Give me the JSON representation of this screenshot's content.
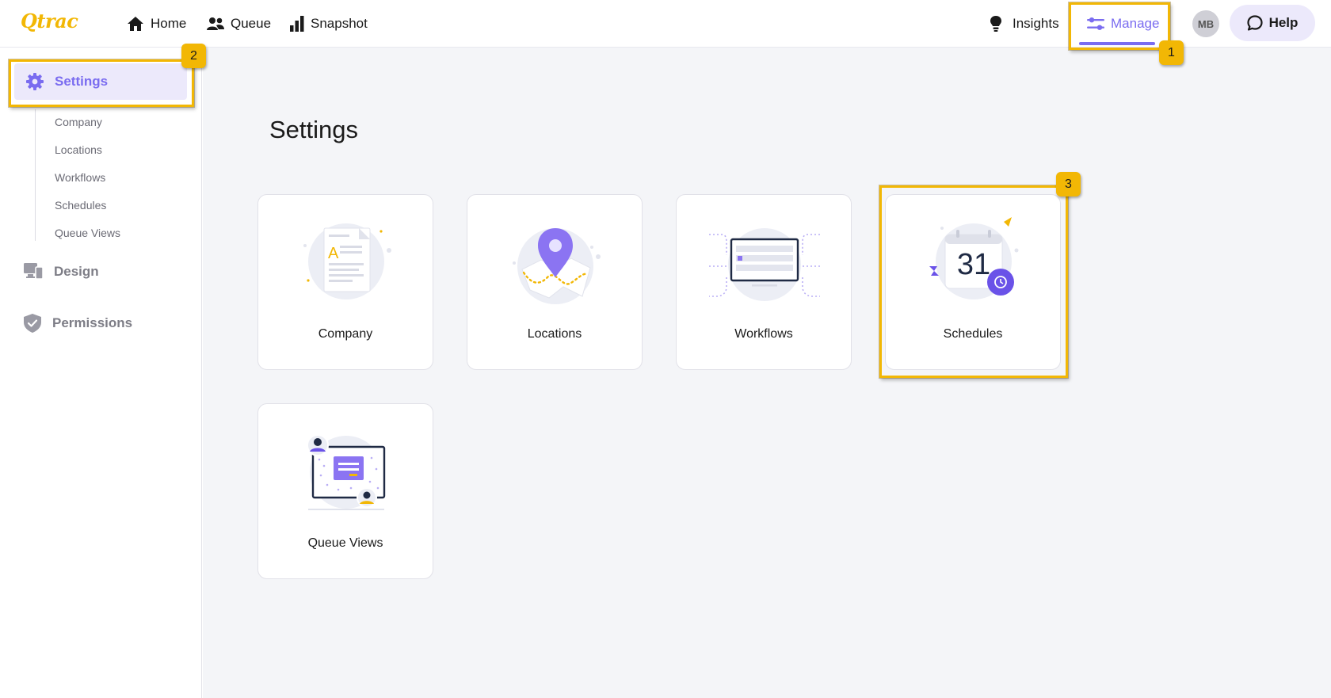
{
  "app": {
    "logo_text": "Qtrac"
  },
  "nav": {
    "home": "Home",
    "queue": "Queue",
    "snapshot": "Snapshot",
    "insights": "Insights",
    "manage": "Manage"
  },
  "user": {
    "initials": "MB"
  },
  "help": {
    "label": "Help"
  },
  "sidebar": {
    "settings": "Settings",
    "sub_items": [
      "Company",
      "Locations",
      "Workflows",
      "Schedules",
      "Queue Views"
    ],
    "design": "Design",
    "permissions": "Permissions"
  },
  "main": {
    "title": "Settings",
    "cards": [
      "Company",
      "Locations",
      "Workflows",
      "Schedules",
      "Queue Views"
    ],
    "calendar_day": "31"
  },
  "callouts": [
    "1",
    "2",
    "3"
  ],
  "colors": {
    "accent": "#7a6cf0",
    "highlight": "#f2b705",
    "accent_bg": "#ece9fb"
  }
}
